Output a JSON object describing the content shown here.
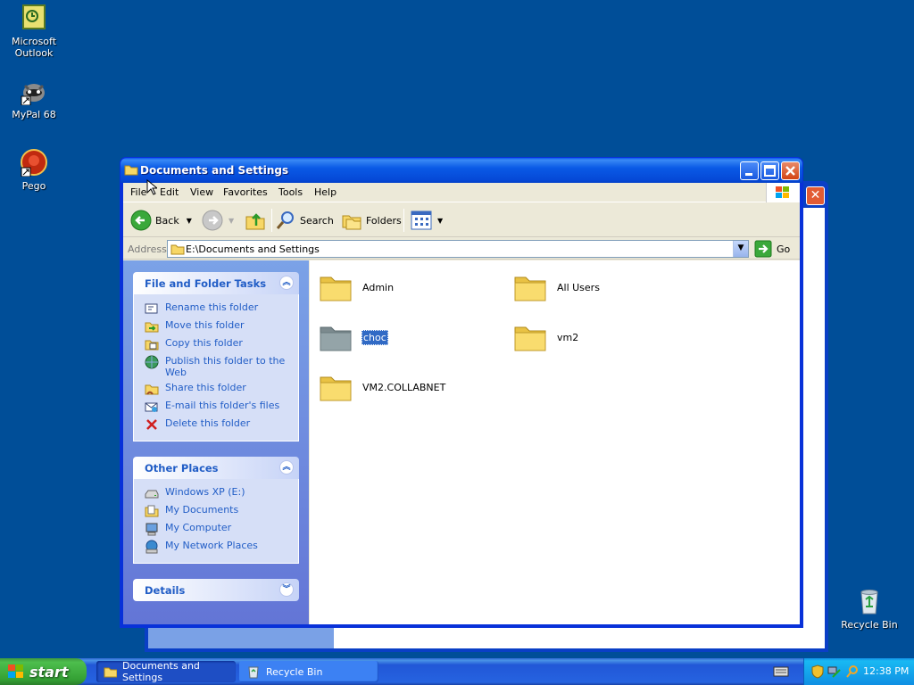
{
  "desktop": {
    "icons": [
      {
        "label": "Microsoft Outlook"
      },
      {
        "label": "MyPal 68"
      },
      {
        "label": "Pego"
      },
      {
        "label": "Recycle Bin"
      }
    ]
  },
  "window": {
    "title": "Documents and Settings",
    "menu": [
      "File",
      "Edit",
      "View",
      "Favorites",
      "Tools",
      "Help"
    ],
    "toolbar": {
      "back": "Back",
      "search": "Search",
      "folders": "Folders"
    },
    "address": {
      "label": "Address",
      "value": "E:\\Documents and Settings",
      "go": "Go"
    }
  },
  "tasks_panel": {
    "title": "File and Folder Tasks",
    "items": [
      {
        "label": "Rename this folder"
      },
      {
        "label": "Move this folder"
      },
      {
        "label": "Copy this folder"
      },
      {
        "label": "Publish this folder to the Web"
      },
      {
        "label": "Share this folder"
      },
      {
        "label": "E-mail this folder's files"
      },
      {
        "label": "Delete this folder"
      }
    ]
  },
  "places_panel": {
    "title": "Other Places",
    "items": [
      {
        "label": "Windows XP (E:)"
      },
      {
        "label": "My Documents"
      },
      {
        "label": "My Computer"
      },
      {
        "label": "My Network Places"
      }
    ]
  },
  "details_panel": {
    "title": "Details"
  },
  "folders": [
    {
      "name": "Admin"
    },
    {
      "name": "All Users"
    },
    {
      "name": "choc",
      "selected": true
    },
    {
      "name": "vm2"
    },
    {
      "name": "VM2.COLLABNET"
    }
  ],
  "taskbar": {
    "start": "start",
    "tasks": [
      {
        "label": "Documents and Settings",
        "active": true
      },
      {
        "label": "Recycle Bin",
        "active": false
      }
    ],
    "clock": "12:38 PM"
  },
  "colors": {
    "desktop": "#004e98",
    "titlebar": "#0a5ae6",
    "link": "#215dc6",
    "selection": "#316ac5"
  }
}
